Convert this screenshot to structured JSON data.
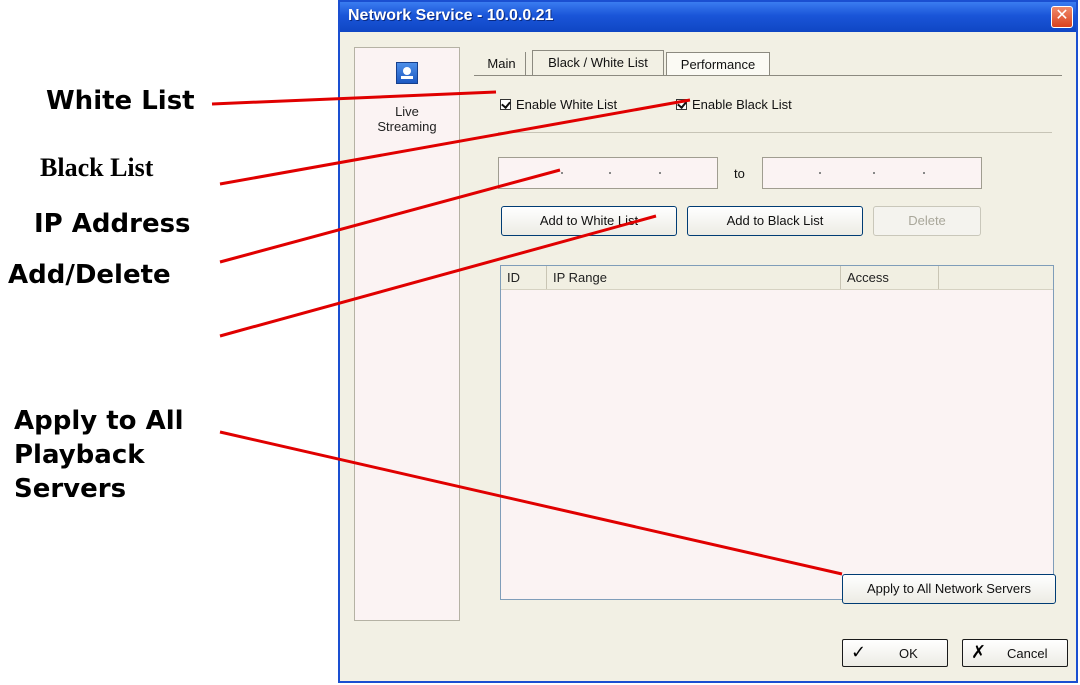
{
  "annotations": {
    "white_list": "White List",
    "black_list": "Black List",
    "ip_address": "IP Address",
    "add_delete": "Add/Delete",
    "apply_all": "Apply to All\nPlayback\nServers",
    "line_color": "#e00000"
  },
  "window": {
    "title": "Network Service - 10.0.0.21",
    "close_glyph": "✕"
  },
  "sidebar": {
    "item_label": "Live\nStreaming",
    "item_icon": "live-streaming-icon"
  },
  "tabs": [
    {
      "label": "Main"
    },
    {
      "label": "Black / White List"
    },
    {
      "label": "Performance"
    }
  ],
  "options": {
    "enable_white": "Enable White List",
    "enable_black": "Enable Black List",
    "white_checked": true,
    "black_checked": true
  },
  "ip_range": {
    "from_value": "",
    "to_label": "to",
    "to_value": ""
  },
  "buttons": {
    "add_white": "Add to White List",
    "add_black": "Add to Black List",
    "delete": "Delete",
    "apply_all": "Apply to All Network Servers",
    "ok": "OK",
    "cancel": "Cancel"
  },
  "list": {
    "columns": [
      "ID",
      "IP Range",
      "Access",
      ""
    ],
    "rows": []
  },
  "colors": {
    "titlebar": "#1a55d8",
    "panel": "#fbf3f3",
    "dialog_bg": "#f2f0e4"
  }
}
